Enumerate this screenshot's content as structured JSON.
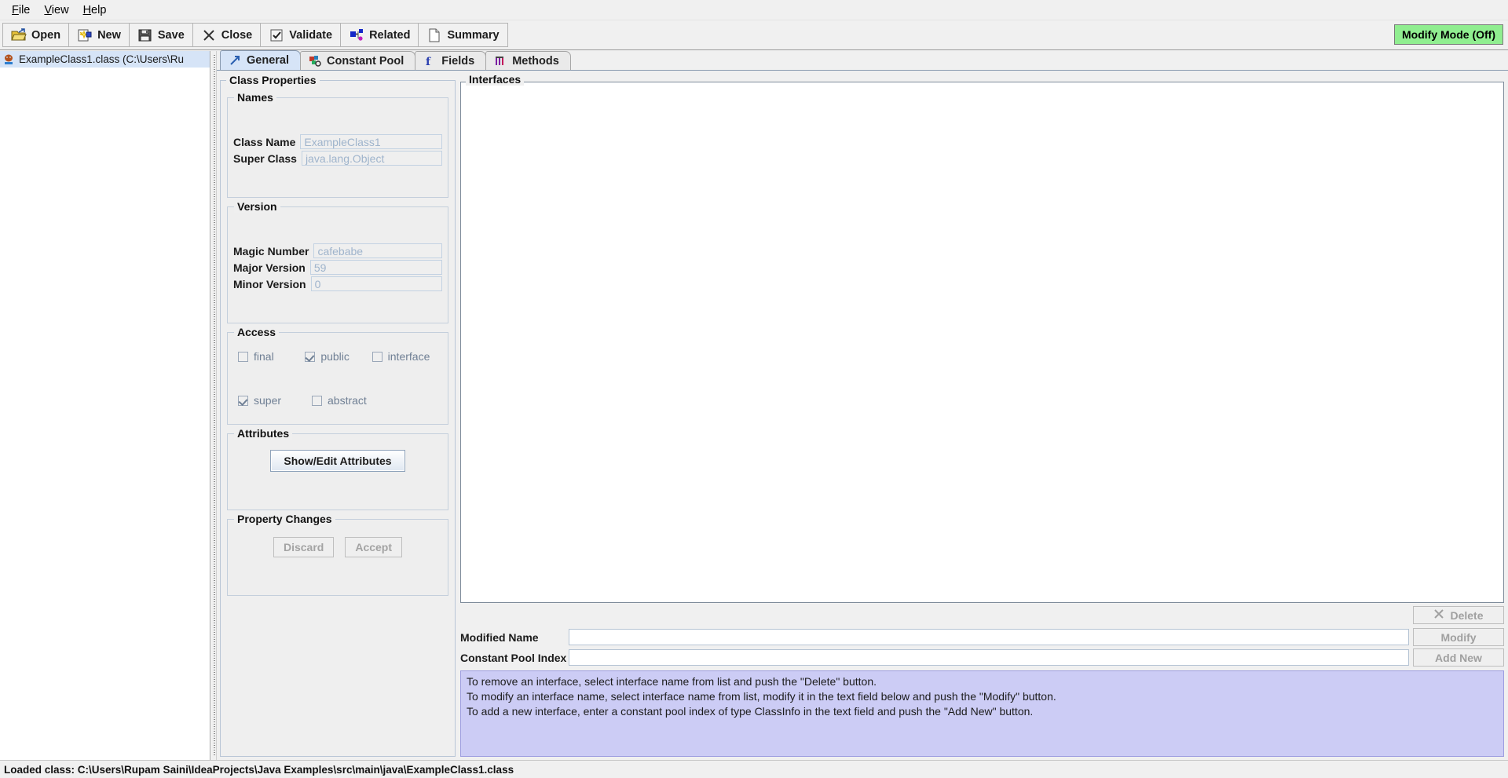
{
  "menu": {
    "items": [
      {
        "label": "File",
        "mnemonic": "F"
      },
      {
        "label": "View",
        "mnemonic": "V"
      },
      {
        "label": "Help",
        "mnemonic": "H"
      }
    ]
  },
  "toolbar": {
    "buttons": [
      {
        "label": "Open",
        "icon": "open-folder-icon"
      },
      {
        "label": "New",
        "icon": "new-file-icon"
      },
      {
        "label": "Save",
        "icon": "floppy-disk-icon"
      },
      {
        "label": "Close",
        "icon": "close-x-icon"
      },
      {
        "label": "Validate",
        "icon": "checkbox-check-icon"
      },
      {
        "label": "Related",
        "icon": "related-nodes-icon"
      },
      {
        "label": "Summary",
        "icon": "document-icon"
      }
    ],
    "modify_mode": {
      "label": "Modify Mode (Off)",
      "color": "#90ee90"
    }
  },
  "tree": {
    "items": [
      {
        "label": "ExampleClass1.class (C:\\Users\\Ru",
        "icon": "java-class-icon",
        "selected": true
      }
    ]
  },
  "tabs": [
    {
      "label": "General",
      "icon": "arrow-up-right-icon",
      "active": true
    },
    {
      "label": "Constant Pool",
      "icon": "constant-pool-icon",
      "active": false
    },
    {
      "label": "Fields",
      "icon": "field-f-icon",
      "active": false
    },
    {
      "label": "Methods",
      "icon": "methods-icon",
      "active": false
    }
  ],
  "class_properties": {
    "title": "Class Properties",
    "names": {
      "title": "Names",
      "fields": [
        {
          "label": "Class Name",
          "value": "ExampleClass1"
        },
        {
          "label": "Super Class",
          "value": "java.lang.Object"
        }
      ]
    },
    "version": {
      "title": "Version",
      "fields": [
        {
          "label": "Magic Number",
          "value": "cafebabe"
        },
        {
          "label": "Major Version",
          "value": "59"
        },
        {
          "label": "Minor Version",
          "value": "0"
        }
      ]
    },
    "access": {
      "title": "Access",
      "row1": [
        {
          "label": "final",
          "checked": false
        },
        {
          "label": "public",
          "checked": true
        },
        {
          "label": "interface",
          "checked": false
        }
      ],
      "row2": [
        {
          "label": "super",
          "checked": true
        },
        {
          "label": "abstract",
          "checked": false
        }
      ]
    },
    "attributes": {
      "title": "Attributes",
      "button": "Show/Edit Attributes"
    },
    "property_changes": {
      "title": "Property Changes",
      "discard": "Discard",
      "accept": "Accept"
    }
  },
  "interfaces": {
    "title": "Interfaces",
    "list_items": [],
    "delete_button": "Delete",
    "modified_name": {
      "label": "Modified Name",
      "value": "",
      "button": "Modify"
    },
    "constant_pool_index": {
      "label": "Constant Pool Index",
      "value": "",
      "button": "Add New"
    },
    "help": [
      "To remove an interface, select interface name from list and push the \"Delete\" button.",
      "To modify an interface name, select interface name from list, modify it in the text field below and push the \"Modify\" button.",
      "To add a new interface, enter a constant pool index of type ClassInfo in the text field and push the \"Add New\" button."
    ]
  },
  "statusbar": {
    "text": "Loaded class: C:\\Users\\Rupam Saini\\IdeaProjects\\Java Examples\\src\\main\\java\\ExampleClass1.class"
  }
}
